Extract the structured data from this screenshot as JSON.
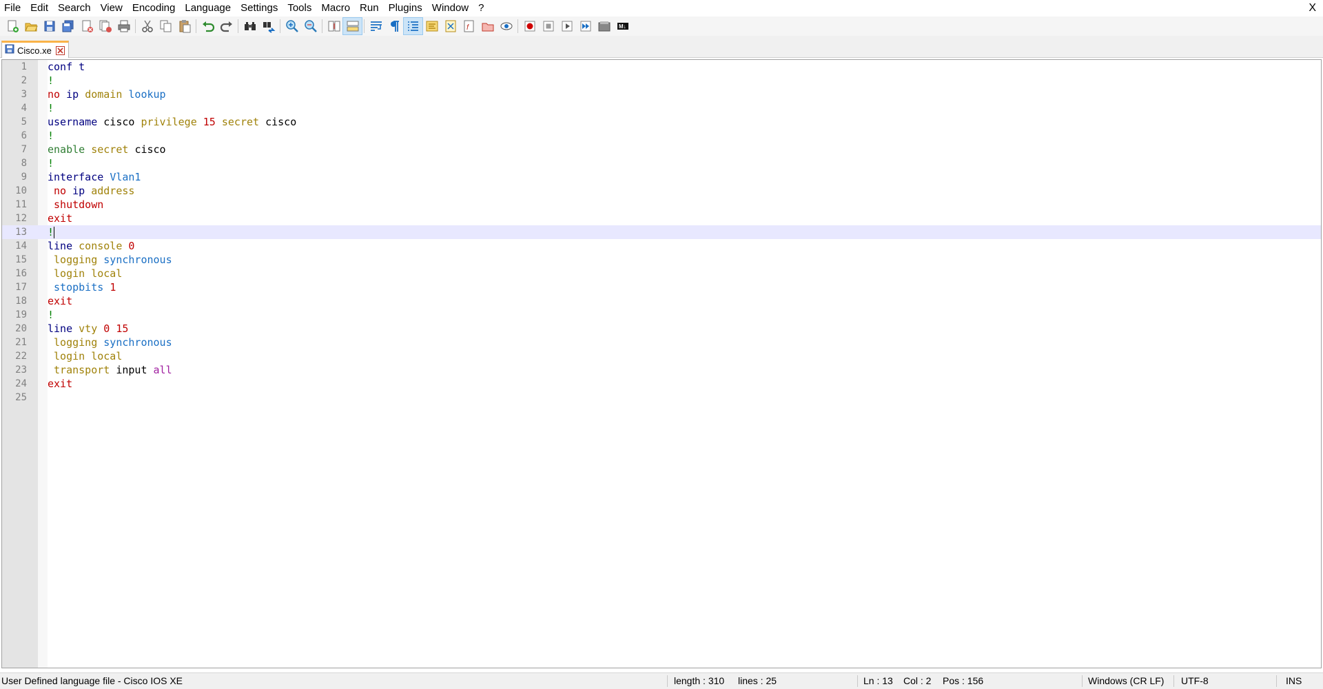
{
  "menu": {
    "items": [
      "File",
      "Edit",
      "Search",
      "View",
      "Encoding",
      "Language",
      "Settings",
      "Tools",
      "Macro",
      "Run",
      "Plugins",
      "Window",
      "?"
    ],
    "close": "X"
  },
  "toolbar": {
    "icons": [
      "new-file",
      "open-file",
      "save",
      "save-all",
      "close",
      "close-all",
      "print",
      "cut",
      "copy",
      "paste",
      "undo",
      "redo",
      "find",
      "replace",
      "zoom-in",
      "zoom-out",
      "sync-vertical",
      "sync-horizontal",
      "word-wrap",
      "show-all-characters",
      "indent-guide",
      "user-defined-language",
      "document-map",
      "function-list",
      "folder-as-workspace",
      "monitoring",
      "record-macro",
      "stop-recording",
      "playback-macro",
      "run-macro-multiple",
      "save-macro",
      "markdown"
    ]
  },
  "tab": {
    "label": "Cisco.xe"
  },
  "editor": {
    "current_line": 13,
    "lines": [
      [
        [
          "conf t",
          "kw"
        ]
      ],
      [
        [
          "!",
          "bang"
        ]
      ],
      [
        [
          "no ",
          "neg"
        ],
        [
          "ip ",
          "kw"
        ],
        [
          "domain ",
          "gold"
        ],
        [
          "lookup",
          "blue"
        ]
      ],
      [
        [
          "!",
          "bang"
        ]
      ],
      [
        [
          "username ",
          "kw"
        ],
        [
          "cisco ",
          "plain"
        ],
        [
          "privilege ",
          "gold"
        ],
        [
          "15 ",
          "red"
        ],
        [
          "secret ",
          "gold"
        ],
        [
          "cisco",
          "plain"
        ]
      ],
      [
        [
          "!",
          "bang"
        ]
      ],
      [
        [
          "enable ",
          "green"
        ],
        [
          "secret ",
          "gold"
        ],
        [
          "cisco",
          "plain"
        ]
      ],
      [
        [
          "!",
          "bang"
        ]
      ],
      [
        [
          "interface ",
          "kw"
        ],
        [
          "Vlan1",
          "blue"
        ]
      ],
      [
        [
          " no ",
          "neg"
        ],
        [
          "ip ",
          "kw"
        ],
        [
          "address",
          "gold"
        ]
      ],
      [
        [
          " shutdown",
          "red"
        ]
      ],
      [
        [
          "exit",
          "red"
        ]
      ],
      [
        [
          "!",
          "bang"
        ]
      ],
      [
        [
          "line ",
          "kw"
        ],
        [
          "console ",
          "gold"
        ],
        [
          "0",
          "red"
        ]
      ],
      [
        [
          " logging ",
          "gold"
        ],
        [
          "synchronous",
          "blue"
        ]
      ],
      [
        [
          " login ",
          "gold"
        ],
        [
          "local",
          "gold"
        ]
      ],
      [
        [
          " stopbits ",
          "blue"
        ],
        [
          "1",
          "red"
        ]
      ],
      [
        [
          "exit",
          "red"
        ]
      ],
      [
        [
          "!",
          "bang"
        ]
      ],
      [
        [
          "line ",
          "kw"
        ],
        [
          "vty ",
          "gold"
        ],
        [
          "0 ",
          "red"
        ],
        [
          "15",
          "red"
        ]
      ],
      [
        [
          " logging ",
          "gold"
        ],
        [
          "synchronous",
          "blue"
        ]
      ],
      [
        [
          " login ",
          "gold"
        ],
        [
          "local",
          "gold"
        ]
      ],
      [
        [
          " transport ",
          "gold"
        ],
        [
          "input ",
          "plain"
        ],
        [
          "all",
          "purple"
        ]
      ],
      [
        [
          "exit",
          "red"
        ]
      ],
      []
    ]
  },
  "status": {
    "language": "User Defined language file - Cisco IOS XE",
    "length": "length : 310",
    "lines": "lines : 25",
    "ln": "Ln : 13",
    "col": "Col : 2",
    "pos": "Pos : 156",
    "eol": "Windows (CR LF)",
    "encoding": "UTF-8",
    "mode": "INS"
  }
}
